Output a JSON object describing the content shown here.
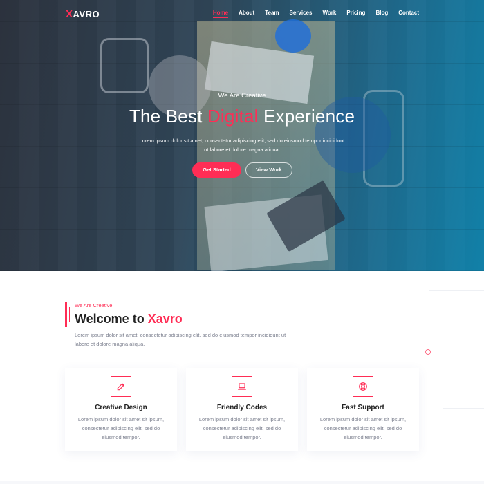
{
  "brand": {
    "logo_initial": "X",
    "logo_rest": "AVRO"
  },
  "nav": {
    "items": [
      {
        "label": "Home",
        "active": true
      },
      {
        "label": "About",
        "active": false
      },
      {
        "label": "Team",
        "active": false
      },
      {
        "label": "Services",
        "active": false
      },
      {
        "label": "Work",
        "active": false
      },
      {
        "label": "Pricing",
        "active": false
      },
      {
        "label": "Blog",
        "active": false
      },
      {
        "label": "Contact",
        "active": false
      }
    ]
  },
  "hero": {
    "subtitle": "We Are Creative",
    "title_before": "The Best ",
    "title_highlight": "Digital",
    "title_after": " Experience",
    "text": "Lorem ipsum dolor sit amet, consectetur adipiscing elit, sed do eiusmod tempor incididunt ut labore et dolore magna aliqua.",
    "primary_button": "Get Started",
    "secondary_button": "View Work"
  },
  "about": {
    "subtitle": "We Are Creative",
    "title_before": "Welcome to ",
    "title_highlight": "Xavro",
    "text": "Lorem ipsum dolor sit amet, consectetur adipiscing elit, sed do eiusmod tempor incididunt ut labore et dolore magna aliqua."
  },
  "features": [
    {
      "icon": "edit-icon",
      "title": "Creative Design",
      "desc": "Lorem ipsum dolor sit amet sit ipsum, consectetur adipiscing elit, sed do eiusmod tempor."
    },
    {
      "icon": "laptop-icon",
      "title": "Friendly Codes",
      "desc": "Lorem ipsum dolor sit amet sit ipsum, consectetur adipiscing elit, sed do eiusmod tempor."
    },
    {
      "icon": "support-icon",
      "title": "Fast Support",
      "desc": "Lorem ipsum dolor sit amet sit ipsum, consectetur adipiscing elit, sed do eiusmod tempor."
    }
  ],
  "colors": {
    "accent": "#ff2d55",
    "text_muted": "#7b7f8e"
  }
}
